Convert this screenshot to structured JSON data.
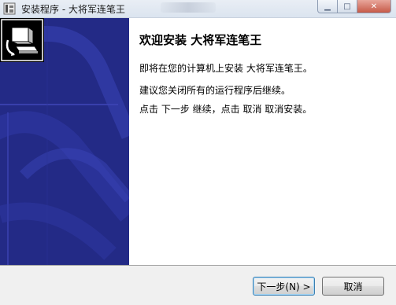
{
  "window": {
    "title": "安装程序 - 大将军连笔王"
  },
  "titlebar_buttons": {
    "minimize": "▁",
    "maximize": "□",
    "close": "✕"
  },
  "content": {
    "heading": "欢迎安装 大将军连笔王",
    "line1": "即将在您的计算机上安装 大将军连笔王。",
    "line2": "建议您关闭所有的运行程序后继续。",
    "line3": "点击 下一步 继续，点击 取消 取消安装。"
  },
  "buttons": {
    "next": "下一步(N) >",
    "cancel": "取消"
  },
  "colors": {
    "side_panel": "#232a86",
    "side_panel_accent": "#3a43b8"
  },
  "icons": {
    "app": "installer-icon",
    "logo": "computer-install-icon"
  }
}
